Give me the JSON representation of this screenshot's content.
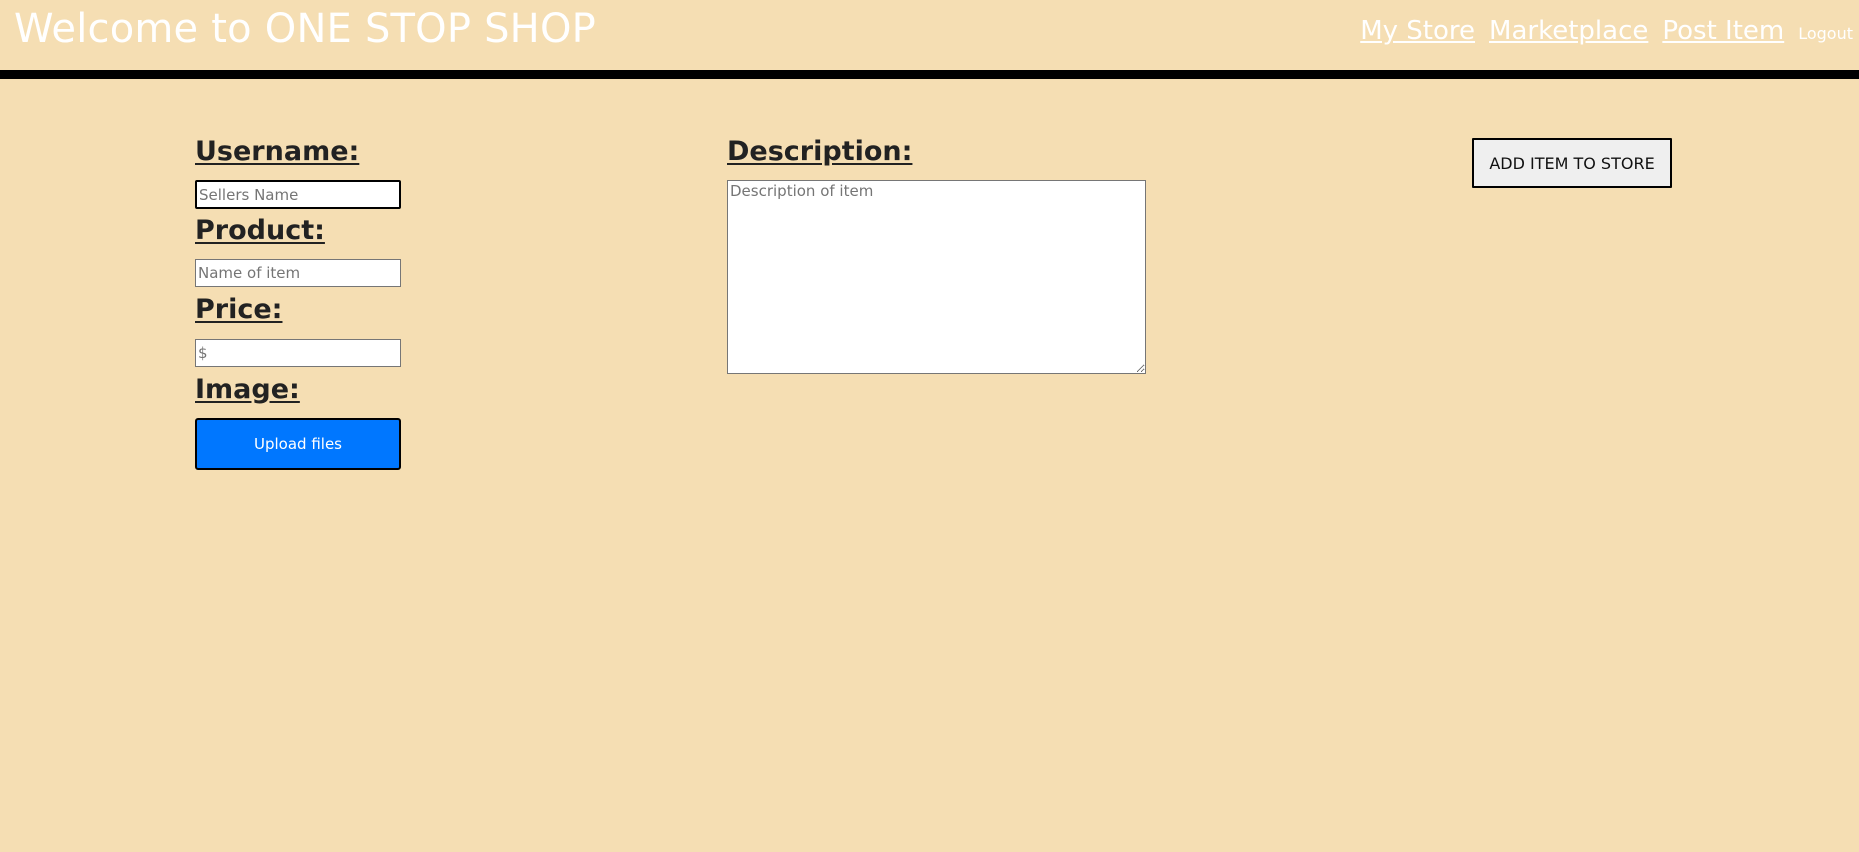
{
  "header": {
    "title": "Welcome to ONE STOP SHOP",
    "nav": {
      "my_store": "My Store",
      "marketplace": "Marketplace",
      "post_item": "Post Item",
      "logout": "Logout"
    }
  },
  "form": {
    "username": {
      "label": "Username:",
      "placeholder": "Sellers Name",
      "value": ""
    },
    "product": {
      "label": "Product:",
      "placeholder": "Name of item",
      "value": ""
    },
    "price": {
      "label": "Price:",
      "placeholder": "$",
      "value": ""
    },
    "image": {
      "label": "Image:",
      "upload_label": "Upload files"
    },
    "description": {
      "label": "Description:",
      "placeholder": "Description of item",
      "value": ""
    },
    "submit_label": "ADD ITEM TO STORE"
  },
  "colors": {
    "background": "#f5deb3",
    "header_text": "#ffffff",
    "upload_button": "#0077ff",
    "header_border": "#000000"
  }
}
